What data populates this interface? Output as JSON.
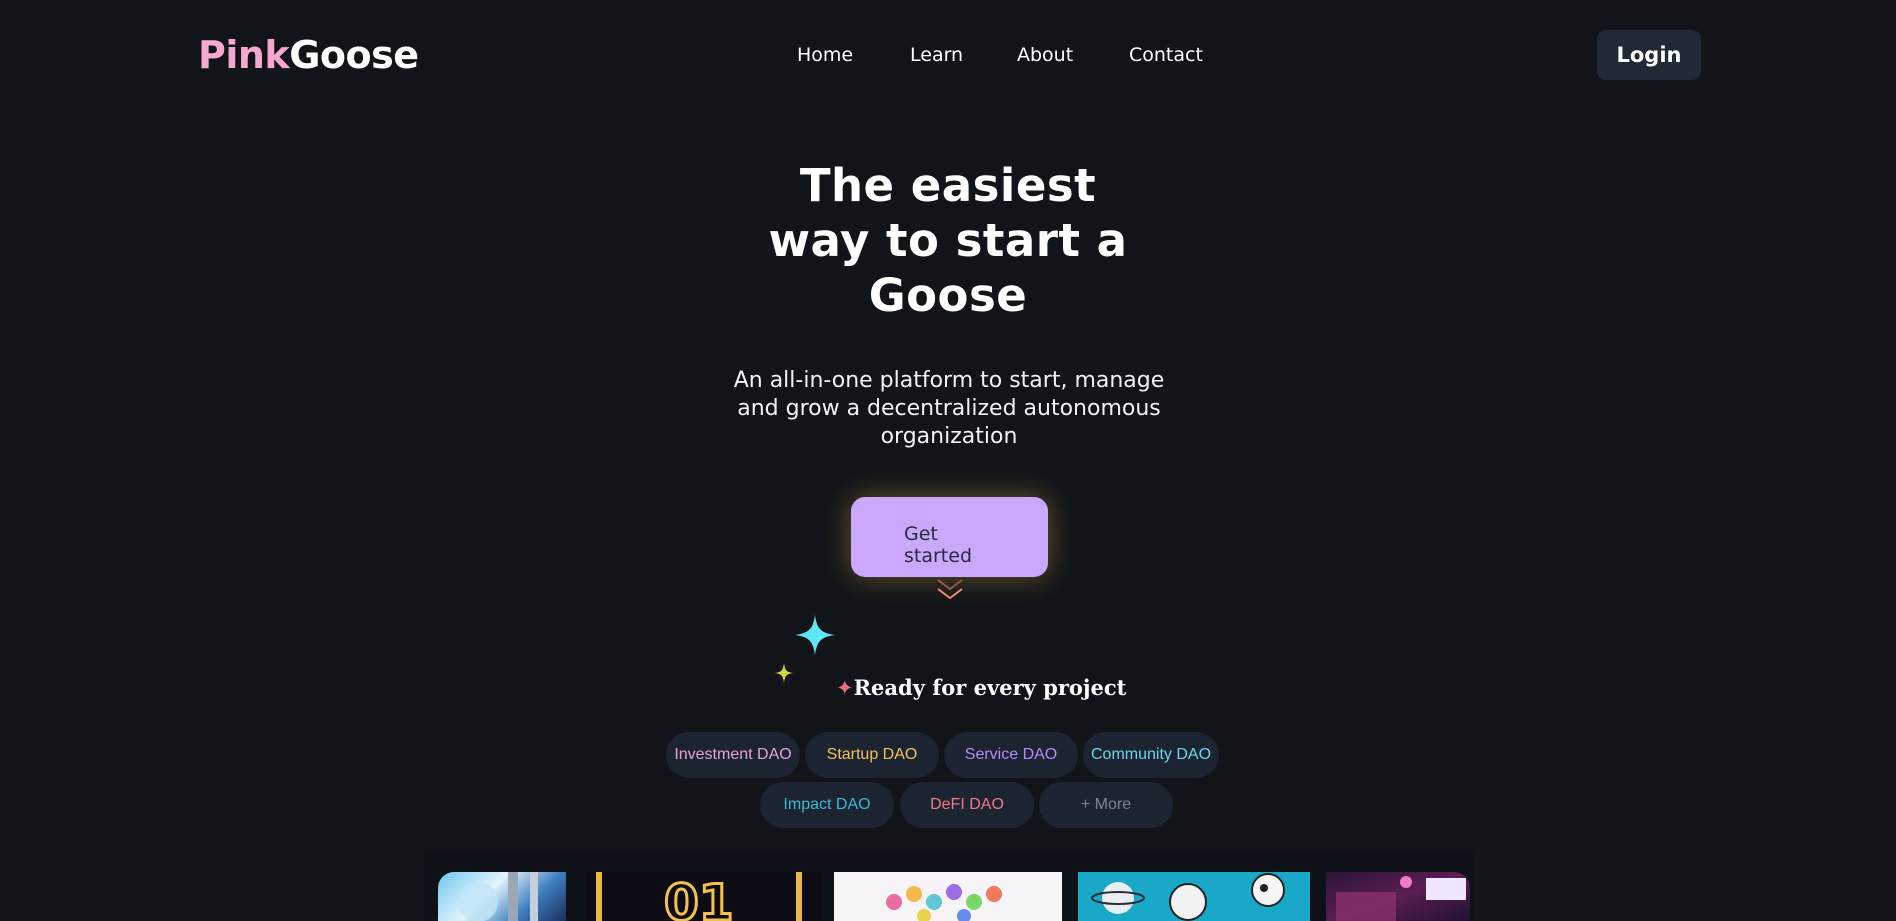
{
  "header": {
    "logo_pink": "Pink",
    "logo_white": "Goose",
    "nav": [
      "Home",
      "Learn",
      "About",
      "Contact"
    ],
    "login_label": "Login"
  },
  "hero": {
    "title_lines": [
      "The easiest",
      "way to start a",
      "Goose"
    ],
    "subtitle_lines": [
      "An all-in-one platform to start, manage",
      "and grow a decentralized autonomous",
      "organization"
    ],
    "cta_lines": [
      "Get",
      "started"
    ]
  },
  "section": {
    "star": "✦",
    "title": "Ready for every project"
  },
  "tags": [
    {
      "label": "Investment DAO",
      "color": "#e8a0d8"
    },
    {
      "label": "Startup DAO",
      "color": "#f2c25a"
    },
    {
      "label": "Service DAO",
      "color": "#b98af5"
    },
    {
      "label": "Community DAO",
      "color": "#6fd3f0"
    },
    {
      "label": "Impact DAO",
      "color": "#3fb8d8"
    },
    {
      "label": "DeFI DAO",
      "color": "#f07a86"
    },
    {
      "label": "+ More",
      "color": "#7a8290"
    }
  ],
  "colors": {
    "background": "#111519",
    "accent_pink": "#f7a8cf",
    "cta": "#caa8fb",
    "login_bg": "#202a36",
    "sparkle_cyan": "#5ee6f5",
    "sparkle_yellow": "#d8d83a",
    "sparkle_pink": "#ef6b7f",
    "chevron": "#f08a6a"
  },
  "icons": [
    "chevron-double-down-icon",
    "sparkle-icon"
  ]
}
